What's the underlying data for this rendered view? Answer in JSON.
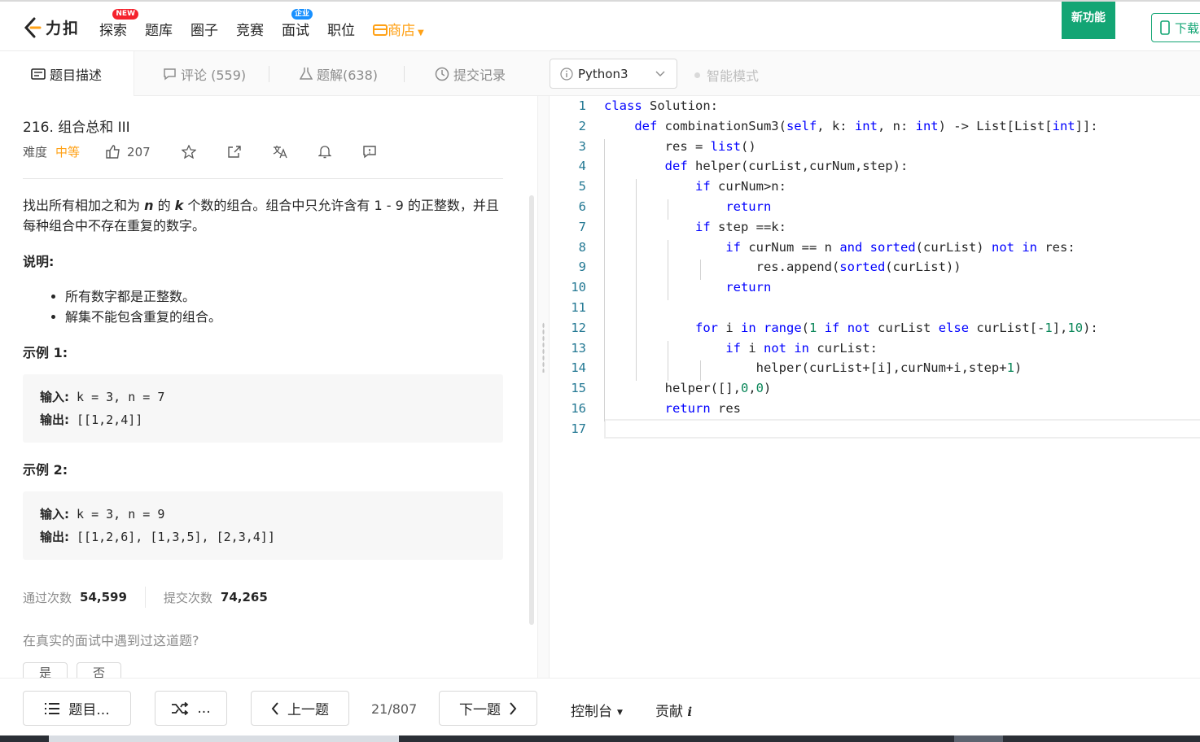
{
  "nav": {
    "logo_text": "力扣",
    "items": [
      {
        "label": "探索",
        "badge": "NEW"
      },
      {
        "label": "题库",
        "badge": ""
      },
      {
        "label": "圈子",
        "badge": ""
      },
      {
        "label": "竞赛",
        "badge": ""
      },
      {
        "label": "面试",
        "badge": "企业"
      },
      {
        "label": "职位",
        "badge": ""
      },
      {
        "label": "商店",
        "badge": ""
      }
    ],
    "new_feature": "新功能",
    "download": "下载"
  },
  "tabs": {
    "description": "题目描述",
    "comments": "评论 (559)",
    "solutions": "题解(638)",
    "submissions": "提交记录",
    "language": "Python3",
    "smart_mode": "智能模式"
  },
  "problem": {
    "title": "216. 组合总和 III",
    "difficulty_label": "难度",
    "difficulty": "中等",
    "likes": "207",
    "desc_1": "找出所有相加之和为 ",
    "desc_n": "n",
    "desc_2": " 的 ",
    "desc_k": "k",
    "desc_3": " 个数的组合。组合中只允许含有 1 - 9 的正整数，并且每种组合中不存在重复的数字。",
    "note_heading": "说明:",
    "notes": [
      "所有数字都是正整数。",
      "解集不能包含重复的组合。"
    ],
    "example1_heading": "示例 1:",
    "example1_in_label": "输入:",
    "example1_in": " k = 3, n = 7",
    "example1_out_label": "输出:",
    "example1_out": " [[1,2,4]]",
    "example2_heading": "示例 2:",
    "example2_in_label": "输入:",
    "example2_in": " k = 3, n = 9",
    "example2_out_label": "输出:",
    "example2_out": " [[1,2,6], [1,3,5], [2,3,4]]",
    "accepted_label": "通过次数",
    "accepted": "54,599",
    "submitted_label": "提交次数",
    "submitted": "74,265",
    "interview_question": "在真实的面试中遇到过这道题?",
    "yes": "是",
    "no": "否"
  },
  "code_lines": [
    "class Solution:",
    "    def combinationSum3(self, k: int, n: int) -> List[List[int]]:",
    "        res = list()",
    "        def helper(curList,curNum,step):",
    "            if curNum>n:",
    "                return",
    "            if step ==k:",
    "                if curNum == n and sorted(curList) not in res:",
    "                    res.append(sorted(curList))",
    "                return",
    "",
    "            for i in range(1 if not curList else curList[-1],10):",
    "                if i not in curList:",
    "                    helper(curList+[i],curNum+i,step+1)",
    "        helper([],0,0)",
    "        return res",
    ""
  ],
  "bottom": {
    "problem_list": "题目...",
    "random": "...",
    "prev": "上一题",
    "pager": "21/807",
    "next": "下一题",
    "console": "控制台",
    "contribute": "贡献"
  }
}
